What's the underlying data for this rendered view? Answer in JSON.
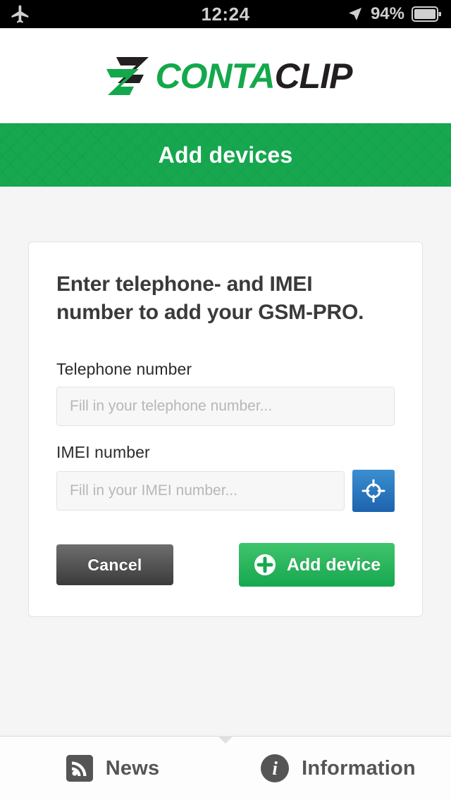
{
  "statusbar": {
    "airplane_icon": "airplane-icon",
    "time": "12:24",
    "location_icon": "location-arrow-icon",
    "battery_percent": "94%",
    "battery_icon": "battery-icon"
  },
  "brand": {
    "logo_mark": "contaclip-logo-mark",
    "name_part1": "CONTA",
    "name_part2": "CLIP",
    "green": "#14a84c",
    "dark": "#231f20"
  },
  "header": {
    "title": "Add devices",
    "background": "#17a74f"
  },
  "card": {
    "heading": "Enter telephone- and IMEI number to add your GSM-PRO.",
    "fields": [
      {
        "label": "Telephone number",
        "placeholder": "Fill in your telephone number...",
        "value": ""
      },
      {
        "label": "IMEI number",
        "placeholder": "Fill in your IMEI number...",
        "value": ""
      }
    ],
    "scan_button_icon": "scan-target-icon",
    "scan_button_color": "#1d63ad",
    "cancel_label": "Cancel",
    "add_label": "Add device",
    "add_icon": "plus-circle-icon",
    "add_color": "#17a74f"
  },
  "tabbar": {
    "items": [
      {
        "label": "News",
        "icon": "rss-icon"
      },
      {
        "label": "Information",
        "icon": "info-icon"
      }
    ]
  }
}
